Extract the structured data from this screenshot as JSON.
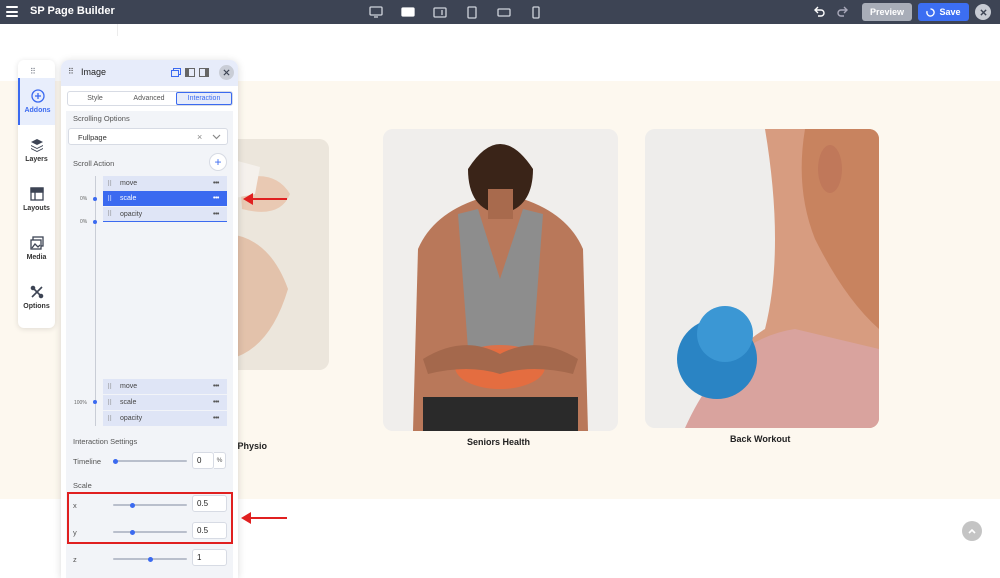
{
  "app": {
    "title": "SP Page Builder",
    "preview_label": "Preview",
    "save_label": "Save"
  },
  "sidebar": {
    "items": [
      {
        "label": "Addons",
        "icon": "plus-circle-icon"
      },
      {
        "label": "Layers",
        "icon": "layers-icon"
      },
      {
        "label": "Layouts",
        "icon": "layouts-icon"
      },
      {
        "label": "Media",
        "icon": "media-icon"
      },
      {
        "label": "Options",
        "icon": "options-icon"
      }
    ]
  },
  "panel": {
    "title": "Image",
    "tabs": [
      "Style",
      "Advanced",
      "Interaction"
    ],
    "active_tab": "Interaction",
    "scrolling_options_label": "Scrolling Options",
    "scrolling_options_value": "Fullpage",
    "scroll_action_label": "Scroll Action",
    "timeline_markers": [
      "0%",
      "0%",
      "100%"
    ],
    "start_actions": [
      {
        "name": "move",
        "active": false
      },
      {
        "name": "scale",
        "active": true
      },
      {
        "name": "opacity",
        "active": false
      }
    ],
    "end_actions": [
      {
        "name": "move"
      },
      {
        "name": "scale"
      },
      {
        "name": "opacity"
      }
    ],
    "interaction_settings_label": "Interaction Settings",
    "timeline_label": "Timeline",
    "timeline_value": "0",
    "timeline_unit": "%",
    "scale_label": "Scale",
    "scale": {
      "x_label": "x",
      "x_value": "0.5",
      "y_label": "y",
      "y_value": "0.5",
      "z_label": "z",
      "z_value": "1"
    }
  },
  "cards": [
    {
      "caption": "e Physio"
    },
    {
      "caption": "Seniors Health"
    },
    {
      "caption": "Back Workout"
    }
  ],
  "colors": {
    "accent": "#3b6af0",
    "topbar": "#3d4454",
    "section_bg": "#fdf8ef",
    "annotation": "#e02020"
  }
}
